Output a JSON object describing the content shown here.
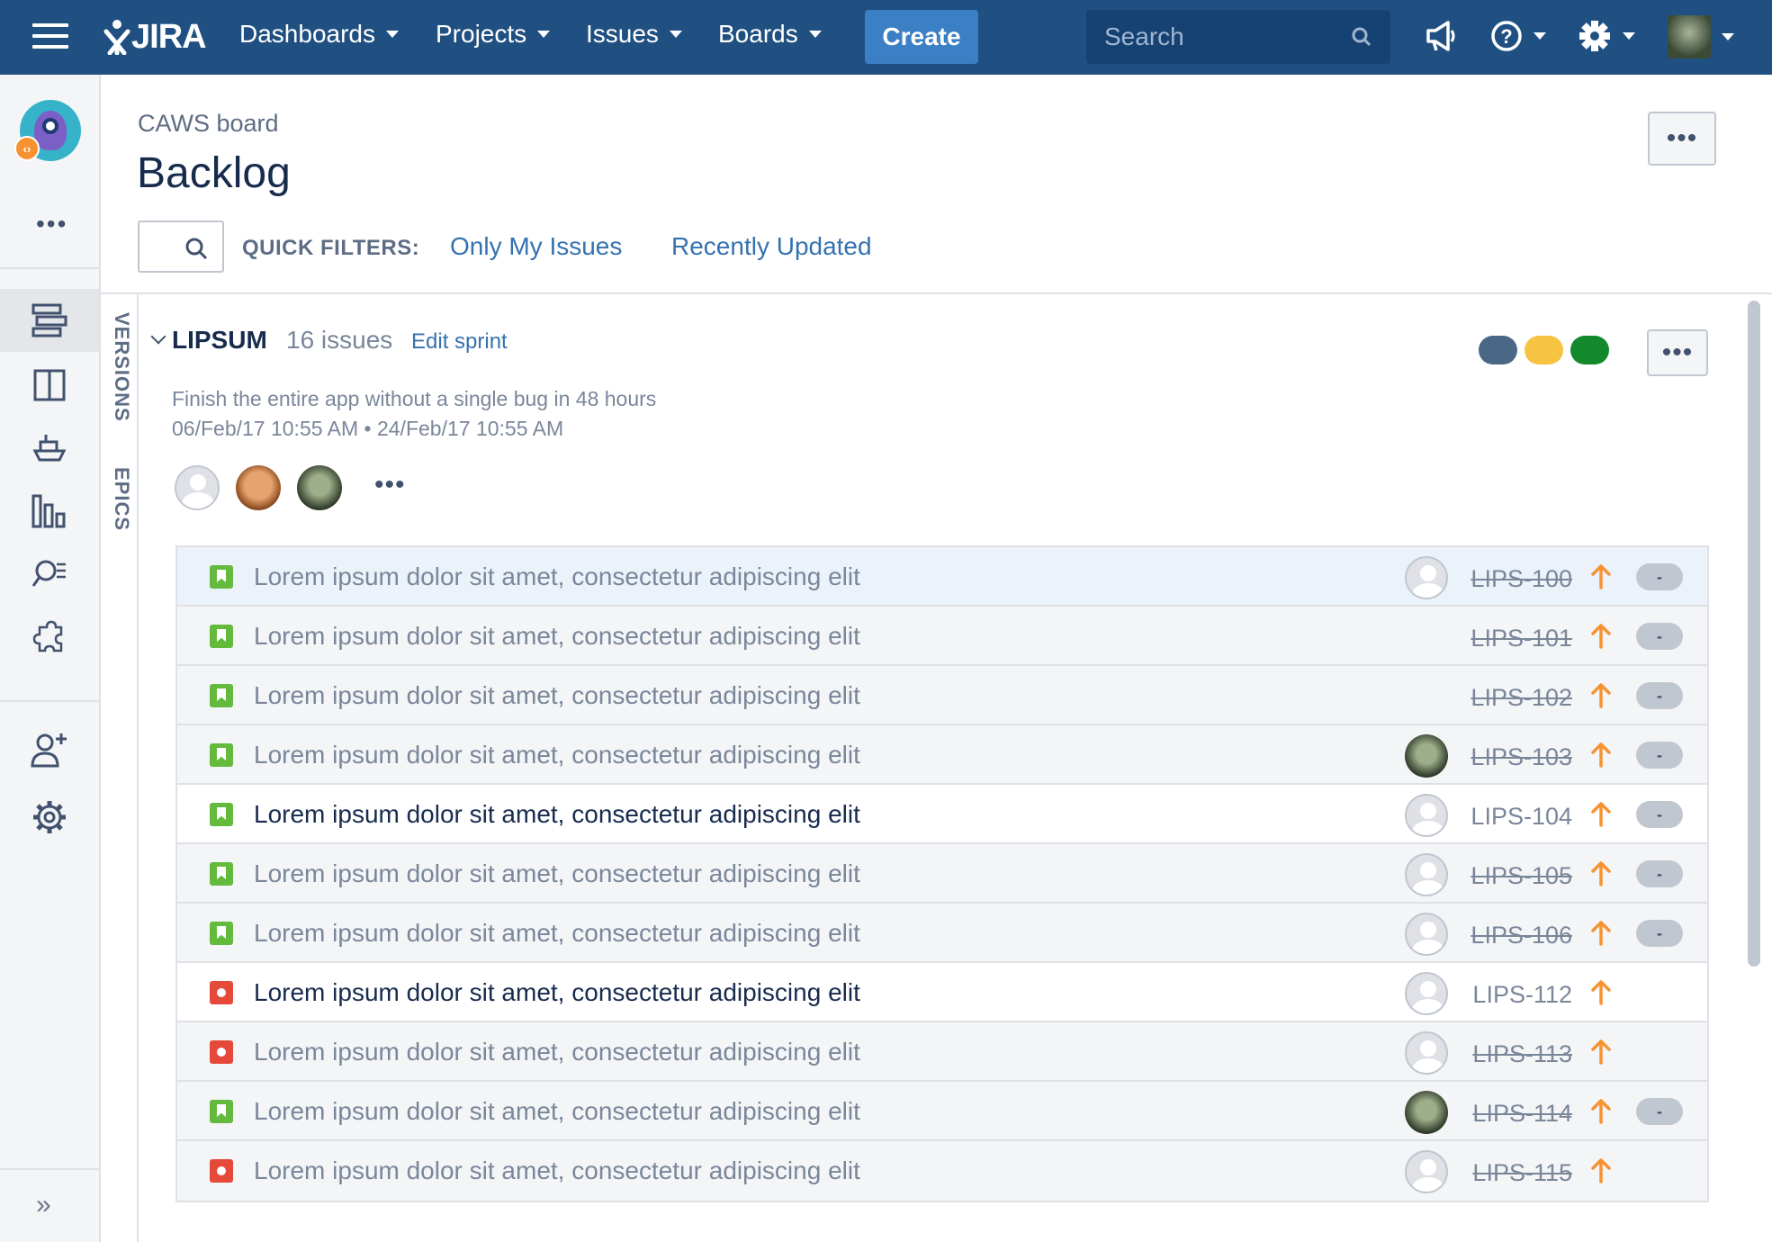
{
  "nav": {
    "logo": "JIRA",
    "menus": [
      "Dashboards",
      "Projects",
      "Issues",
      "Boards"
    ],
    "create_label": "Create",
    "search_placeholder": "Search"
  },
  "header": {
    "breadcrumb": "CAWS board",
    "title": "Backlog",
    "quick_filters_label": "QUICK FILTERS:",
    "quick_filters": [
      "Only My Issues",
      "Recently Updated"
    ]
  },
  "side_tabs": [
    "VERSIONS",
    "EPICS"
  ],
  "sprint": {
    "name": "LIPSUM",
    "count": "16 issues",
    "edit_label": "Edit sprint",
    "goal": "Finish the entire app without a single bug in 48 hours",
    "dates": "06/Feb/17 10:55 AM • 24/Feb/17 10:55 AM",
    "status_colors": [
      "#4a6785",
      "#f6c342",
      "#14892c"
    ]
  },
  "issues": [
    {
      "type": "story",
      "summary": "Lorem ipsum dolor sit amet, consectetur adipiscing elit",
      "key": "LIPS-100",
      "done": true,
      "assignee": "default",
      "estimate": "-",
      "selected": true
    },
    {
      "type": "story",
      "summary": "Lorem ipsum dolor sit amet, consectetur adipiscing elit",
      "key": "LIPS-101",
      "done": true,
      "assignee": "",
      "estimate": "-"
    },
    {
      "type": "story",
      "summary": "Lorem ipsum dolor sit amet, consectetur adipiscing elit",
      "key": "LIPS-102",
      "done": true,
      "assignee": "",
      "estimate": "-"
    },
    {
      "type": "story",
      "summary": "Lorem ipsum dolor sit amet, consectetur adipiscing elit",
      "key": "LIPS-103",
      "done": true,
      "assignee": "dark",
      "estimate": "-"
    },
    {
      "type": "story",
      "summary": "Lorem ipsum dolor sit amet, consectetur adipiscing elit",
      "key": "LIPS-104",
      "done": false,
      "assignee": "default",
      "estimate": "-"
    },
    {
      "type": "story",
      "summary": "Lorem ipsum dolor sit amet, consectetur adipiscing elit",
      "key": "LIPS-105",
      "done": true,
      "assignee": "default",
      "estimate": "-"
    },
    {
      "type": "story",
      "summary": "Lorem ipsum dolor sit amet, consectetur adipiscing elit",
      "key": "LIPS-106",
      "done": true,
      "assignee": "default",
      "estimate": "-"
    },
    {
      "type": "bug",
      "summary": "Lorem ipsum dolor sit amet, consectetur adipiscing elit",
      "key": "LIPS-112",
      "done": false,
      "assignee": "default",
      "estimate": ""
    },
    {
      "type": "bug",
      "summary": "Lorem ipsum dolor sit amet, consectetur adipiscing elit",
      "key": "LIPS-113",
      "done": true,
      "assignee": "default",
      "estimate": ""
    },
    {
      "type": "story",
      "summary": "Lorem ipsum dolor sit amet, consectetur adipiscing elit",
      "key": "LIPS-114",
      "done": true,
      "assignee": "dark",
      "estimate": "-"
    },
    {
      "type": "bug",
      "summary": "Lorem ipsum dolor sit amet, consectetur adipiscing elit",
      "key": "LIPS-115",
      "done": true,
      "assignee": "default",
      "estimate": ""
    }
  ],
  "colors": {
    "nav_bg": "#205081",
    "create_bg": "#3b7fc4",
    "link": "#3572b0",
    "priority": "#f79232"
  }
}
